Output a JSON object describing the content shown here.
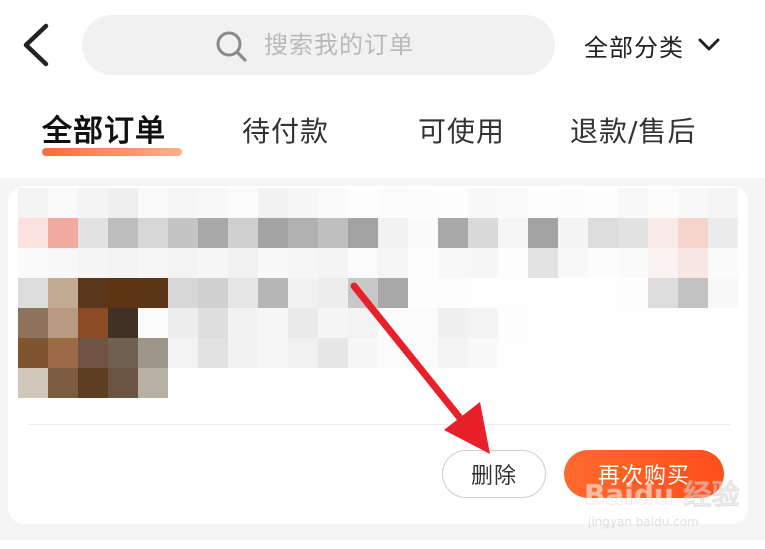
{
  "header": {
    "search_placeholder": "搜索我的订单",
    "category_label": "全部分类"
  },
  "tabs": [
    {
      "label": "全部订单",
      "active": true
    },
    {
      "label": "待付款",
      "active": false
    },
    {
      "label": "可使用",
      "active": false
    },
    {
      "label": "退款/售后",
      "active": false
    }
  ],
  "order_card": {
    "delete_label": "删除",
    "rebuy_label": "再次购买"
  },
  "colors": {
    "accent": "#ff5a24",
    "arrow": "#e8202a"
  },
  "icons": {
    "back": "back-arrow-icon",
    "search": "search-icon",
    "dropdown": "chevron-down-icon",
    "watermark": "baidu-jingyan-watermark"
  },
  "watermark": {
    "brand": "Baidu 经验",
    "url": "jingyan.baidu.com"
  }
}
